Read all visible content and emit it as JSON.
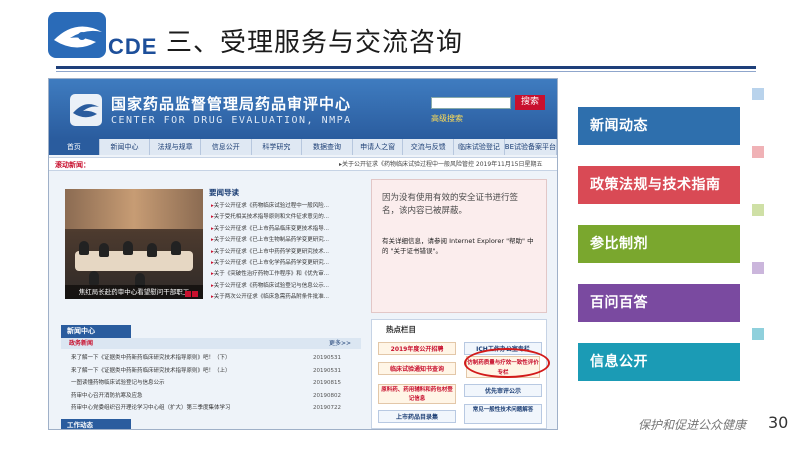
{
  "logo": {
    "text": "CDE"
  },
  "slide": {
    "title": "三、受理服务与交流咨询",
    "footer_tagline": "保护和促进公众健康",
    "page_number": "30"
  },
  "website": {
    "title_cn": "国家药品监督管理局药品审评中心",
    "title_en": "CENTER FOR DRUG EVALUATION, NMPA",
    "search_button": "搜索",
    "advanced_search": "高级搜索",
    "nav": [
      "首页",
      "新闻中心",
      "法规与规章",
      "信息公开",
      "科学研究",
      "数据查询",
      "申请人之窗",
      "交流与反馈",
      "临床试验登记",
      "BE试验备案平台"
    ],
    "ticker_label": "滚动新闻：",
    "ticker_text": "▸关于公开征求《药物临床试验过程中一般风险管控  2019年11月15日星期五",
    "photo_caption": "焦红局长赴药审中心看望慰问干部职工",
    "news_heading": "要闻导读",
    "news_items": [
      "关于公开征求《药物临床试验过程中一般风险...",
      "关于受托相关技术指导原则和文件征求意见的...",
      "关于公开征求《已上市药品临床变更技术指导...",
      "关于公开征求《已上市生物制品药学变更研究...",
      "关于公开征求《已上市中药药学变更研究技术...",
      "关于公开征求《已上市化学药品药学变更研究...",
      "关于《突破性治疗药物工作程序》和《优先审...",
      "关于公开征求《药物临床试验登记与信息公示...",
      "关于两次公开征求《临床急需药品附条件批准..."
    ],
    "cert_main": "因为没有使用有效的安全证书进行签名，该内容已被屏蔽。",
    "cert_sub": "有关详细信息，请参阅 Internet Explorer \"帮助\" 中的 \"关于证书错误\"。",
    "news_center_title": "新闻中心",
    "news_sub": "政务新闻",
    "more_label": "更多>>",
    "notices": [
      {
        "title": "来了解一下《证据类中药新药临床研究技术指导原则》吧！（下）",
        "date": "20190531"
      },
      {
        "title": "来了解一下《证据类中药新药临床研究技术指导原则》吧！（上）",
        "date": "20190531"
      },
      {
        "title": "一图读懂药物临床试验登记与信息公示",
        "date": "20190815"
      },
      {
        "title": "药审中心召开消防抗寒及应急",
        "date": "20190802"
      },
      {
        "title": "药审中心党委组织召开理论学习中心组（扩大）第三季度集体学习",
        "date": "20190722"
      }
    ],
    "work_tab": "工作动态",
    "hot_title": "热点栏目",
    "hot_buttons": [
      "2019年度公开招聘",
      "ICH工作办公室专栏",
      "临床试验通知书查询",
      "仿制药质量与疗效一致性评价专栏",
      "原料药、药用辅料和药包材登记信息",
      "优先审评公示",
      "上市药品目录集",
      "常见一般性技术问题解答"
    ]
  },
  "menu": [
    {
      "label": "新闻动态",
      "color": "#2e6fad"
    },
    {
      "label": "政策法规与技术指南",
      "color": "#d94a55"
    },
    {
      "label": "参比制剂",
      "color": "#7aa72e"
    },
    {
      "label": "百问百答",
      "color": "#7a4aa0"
    },
    {
      "label": "信息公开",
      "color": "#1b9bb5"
    }
  ],
  "colors": {
    "header_rule": "#1e3f7a",
    "site_blue": "#2a5c9e",
    "site_red": "#c8102e",
    "square_colors": [
      "#b9d3ec",
      "#f0b2b6",
      "#cfe0a6",
      "#cbb6dc",
      "#8fd0dc"
    ]
  }
}
